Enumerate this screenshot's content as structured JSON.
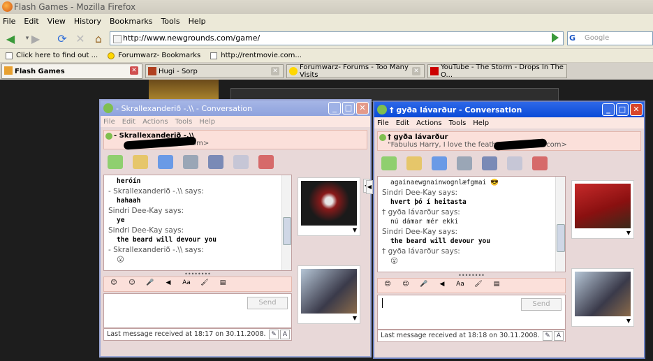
{
  "browser": {
    "title": "Flash Games - Mozilla Firefox",
    "menu": [
      "File",
      "Edit",
      "View",
      "History",
      "Bookmarks",
      "Tools",
      "Help"
    ],
    "url": "http://www.newgrounds.com/game/",
    "search_placeholder": "Google",
    "bookmarks": [
      "Click here to find out ...",
      "Forumwarz- Bookmarks",
      "http://rentmovie.com..."
    ],
    "tabs": [
      {
        "label": "Flash Games",
        "active": true
      },
      {
        "label": "Hugi - Sorp",
        "active": false
      },
      {
        "label": "Forumwarz- Forums - Too Many Visits",
        "active": false
      },
      {
        "label": "YouTube - The Storm - Drops In The O...",
        "active": false
      }
    ]
  },
  "windows": [
    {
      "title": "- Skrallexanderið -.\\\\ - Conversation",
      "menu": [
        "File",
        "Edit",
        "Actions",
        "Tools",
        "Help"
      ],
      "contact_name": "- Skrallexanderið -.\\\\",
      "contact_email_tail": "om>",
      "chat": [
        {
          "type": "msg",
          "text": "heróín"
        },
        {
          "type": "says",
          "text": "- Skrallexanderið -.\\\\ says:"
        },
        {
          "type": "msg",
          "text": "hahaah"
        },
        {
          "type": "says",
          "text": "Sindri Dee-Kay says:"
        },
        {
          "type": "msg",
          "text": "ye"
        },
        {
          "type": "says",
          "text": "Sindri Dee-Kay says:"
        },
        {
          "type": "msg",
          "text": "the beard will devour you"
        },
        {
          "type": "says",
          "text": "- Skrallexanderið -.\\\\ says:"
        }
      ],
      "send_label": "Send",
      "status": "Last message received at 18:17 on 30.11.2008."
    },
    {
      "title": "† gyða lávarður - Conversation",
      "menu": [
        "File",
        "Edit",
        "Actions",
        "Tools",
        "Help"
      ],
      "contact_name": "† gyða lávarður",
      "contact_message": "\"Fabulus Harry, I love the feathers\"",
      "contact_email_tail": ".com>",
      "chat": [
        {
          "type": "msg",
          "text": "againaewgnainwognlæfgmai"
        },
        {
          "type": "says",
          "text": "Sindri Dee-Kay says:"
        },
        {
          "type": "msg",
          "text": "hvert þó í heitasta"
        },
        {
          "type": "says",
          "text": "† gyða lávarður says:"
        },
        {
          "type": "msg",
          "text": "nú dámar mér ekki"
        },
        {
          "type": "says",
          "text": "Sindri Dee-Kay says:"
        },
        {
          "type": "msg",
          "text": "the beard will devour you"
        },
        {
          "type": "says",
          "text": "† gyða lávarður says:"
        }
      ],
      "send_label": "Send",
      "status": "Last message received at 18:18 on 30.11.2008."
    }
  ]
}
